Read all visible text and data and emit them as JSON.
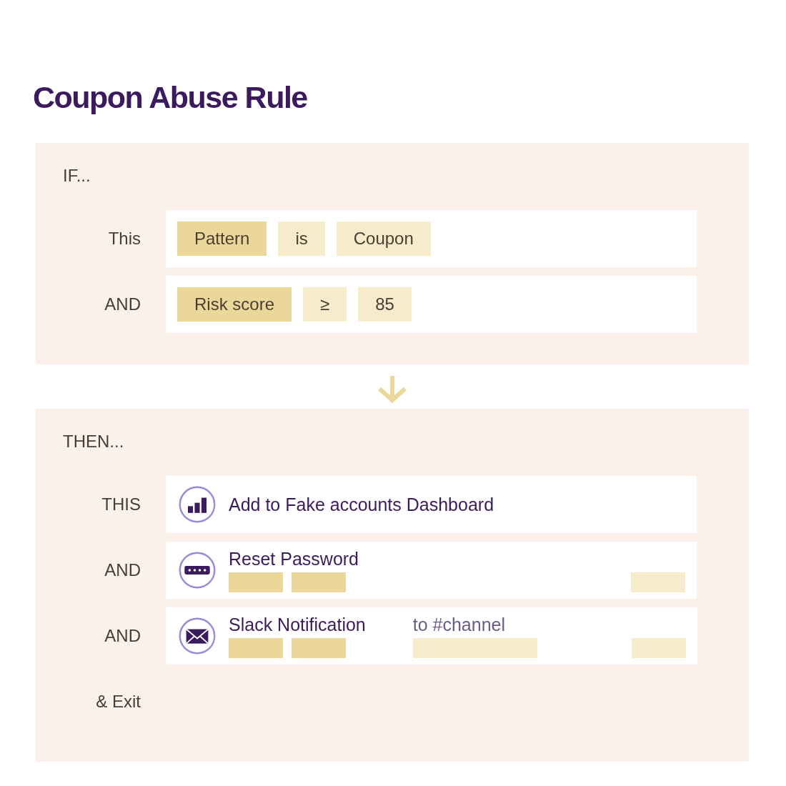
{
  "title": "Coupon Abuse Rule",
  "condition_section": {
    "heading": "IF...",
    "rows": [
      {
        "label": "This",
        "chips": [
          {
            "text": "Pattern",
            "color": "#ecd79a"
          },
          {
            "text": "is",
            "color": "#f6ebca"
          },
          {
            "text": "Coupon",
            "color": "#f6ebca"
          }
        ]
      },
      {
        "label": "AND",
        "chips": [
          {
            "text": "Risk score",
            "color": "#ecd79a"
          },
          {
            "text": "≥",
            "color": "#f6ebca"
          },
          {
            "text": "85",
            "color": "#f6ebca"
          }
        ]
      }
    ]
  },
  "action_section": {
    "heading": "THEN...",
    "rows": [
      {
        "label": "THIS",
        "kind": "dashboard",
        "text": "Add to Fake accounts Dashboard"
      },
      {
        "label": "AND",
        "kind": "password",
        "text": "Reset Password",
        "bars": [
          {
            "color": "#ecd79a"
          },
          {
            "color": "#ecd79a"
          }
        ],
        "right_bar": {
          "color": "#f6ebca"
        }
      },
      {
        "label": "AND",
        "kind": "message",
        "text": "Slack Notification",
        "bars": [
          {
            "color": "#ecd79a"
          },
          {
            "color": "#ecd79a"
          }
        ],
        "note": {
          "text": "to #channel",
          "color": "#f6ebca"
        },
        "right_bar": {
          "color": "#f6ebca"
        }
      }
    ],
    "footer_label": "& Exit"
  }
}
